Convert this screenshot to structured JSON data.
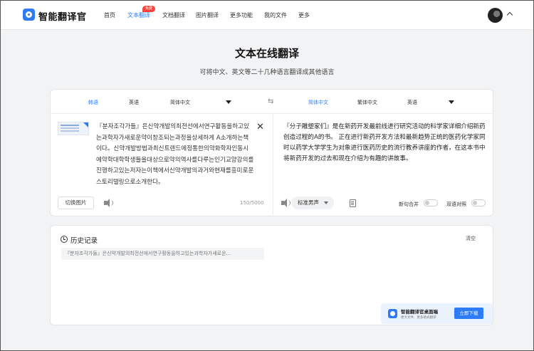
{
  "header": {
    "brand": "智能翻译官",
    "nav": [
      "首页",
      "文本翻译",
      "文档翻译",
      "图片翻译",
      "更多功能",
      "我的文件",
      "更多"
    ],
    "active_nav": "文本翻译",
    "badge": "免费"
  },
  "page": {
    "title": "文本在线翻译",
    "subtitle": "可将中文、英文等二十几种语言翻译成其他语言"
  },
  "source_langs": [
    "韩语",
    "英语",
    "简体中文"
  ],
  "target_langs": [
    "简体中文",
    "繁体中文",
    "英语"
  ],
  "source": {
    "text": "『분자조각가들』은신약개발의최전선에서연구활동을하고있는과학자가새로운약이창조되는과정을상세하게 A소개하는책이다。신약개발방법과최신트렌드에정통한의약화학자인동시에약학대학학생들을대상으로약의역사를다루는인기교양강의를진행하고있는저자는이책에서신약개발의과거와현재를흥미로운스토리텔링으로소개한다。",
    "switch_image": "切换图片",
    "count": "150/5000"
  },
  "target": {
    "text": "『分子雕塑家们』是在新药开发最前线进行研究活动的科学家详细介绍新药创造过程的A的书。 正在进行新药开发方法和最新趋势正统的医药化学家同时以药学大学学生为对象进行医药历史的流行教养讲座的作者，在这本书中将新药开发的过去和现在介绍为有趣的讲故事。",
    "voice": "标准男声",
    "option1": "新句合并",
    "option2": "双语对照"
  },
  "history": {
    "title": "历史记录",
    "clear": "清空",
    "items": [
      "『분자조각가들』은신약개발의최전선에서연구활동을하고있는과학자가새로운..."
    ]
  },
  "promo": {
    "title": "智能翻译官桌面端",
    "subtitle": "更大文件、更多格式翻译",
    "button": "立即下载"
  }
}
